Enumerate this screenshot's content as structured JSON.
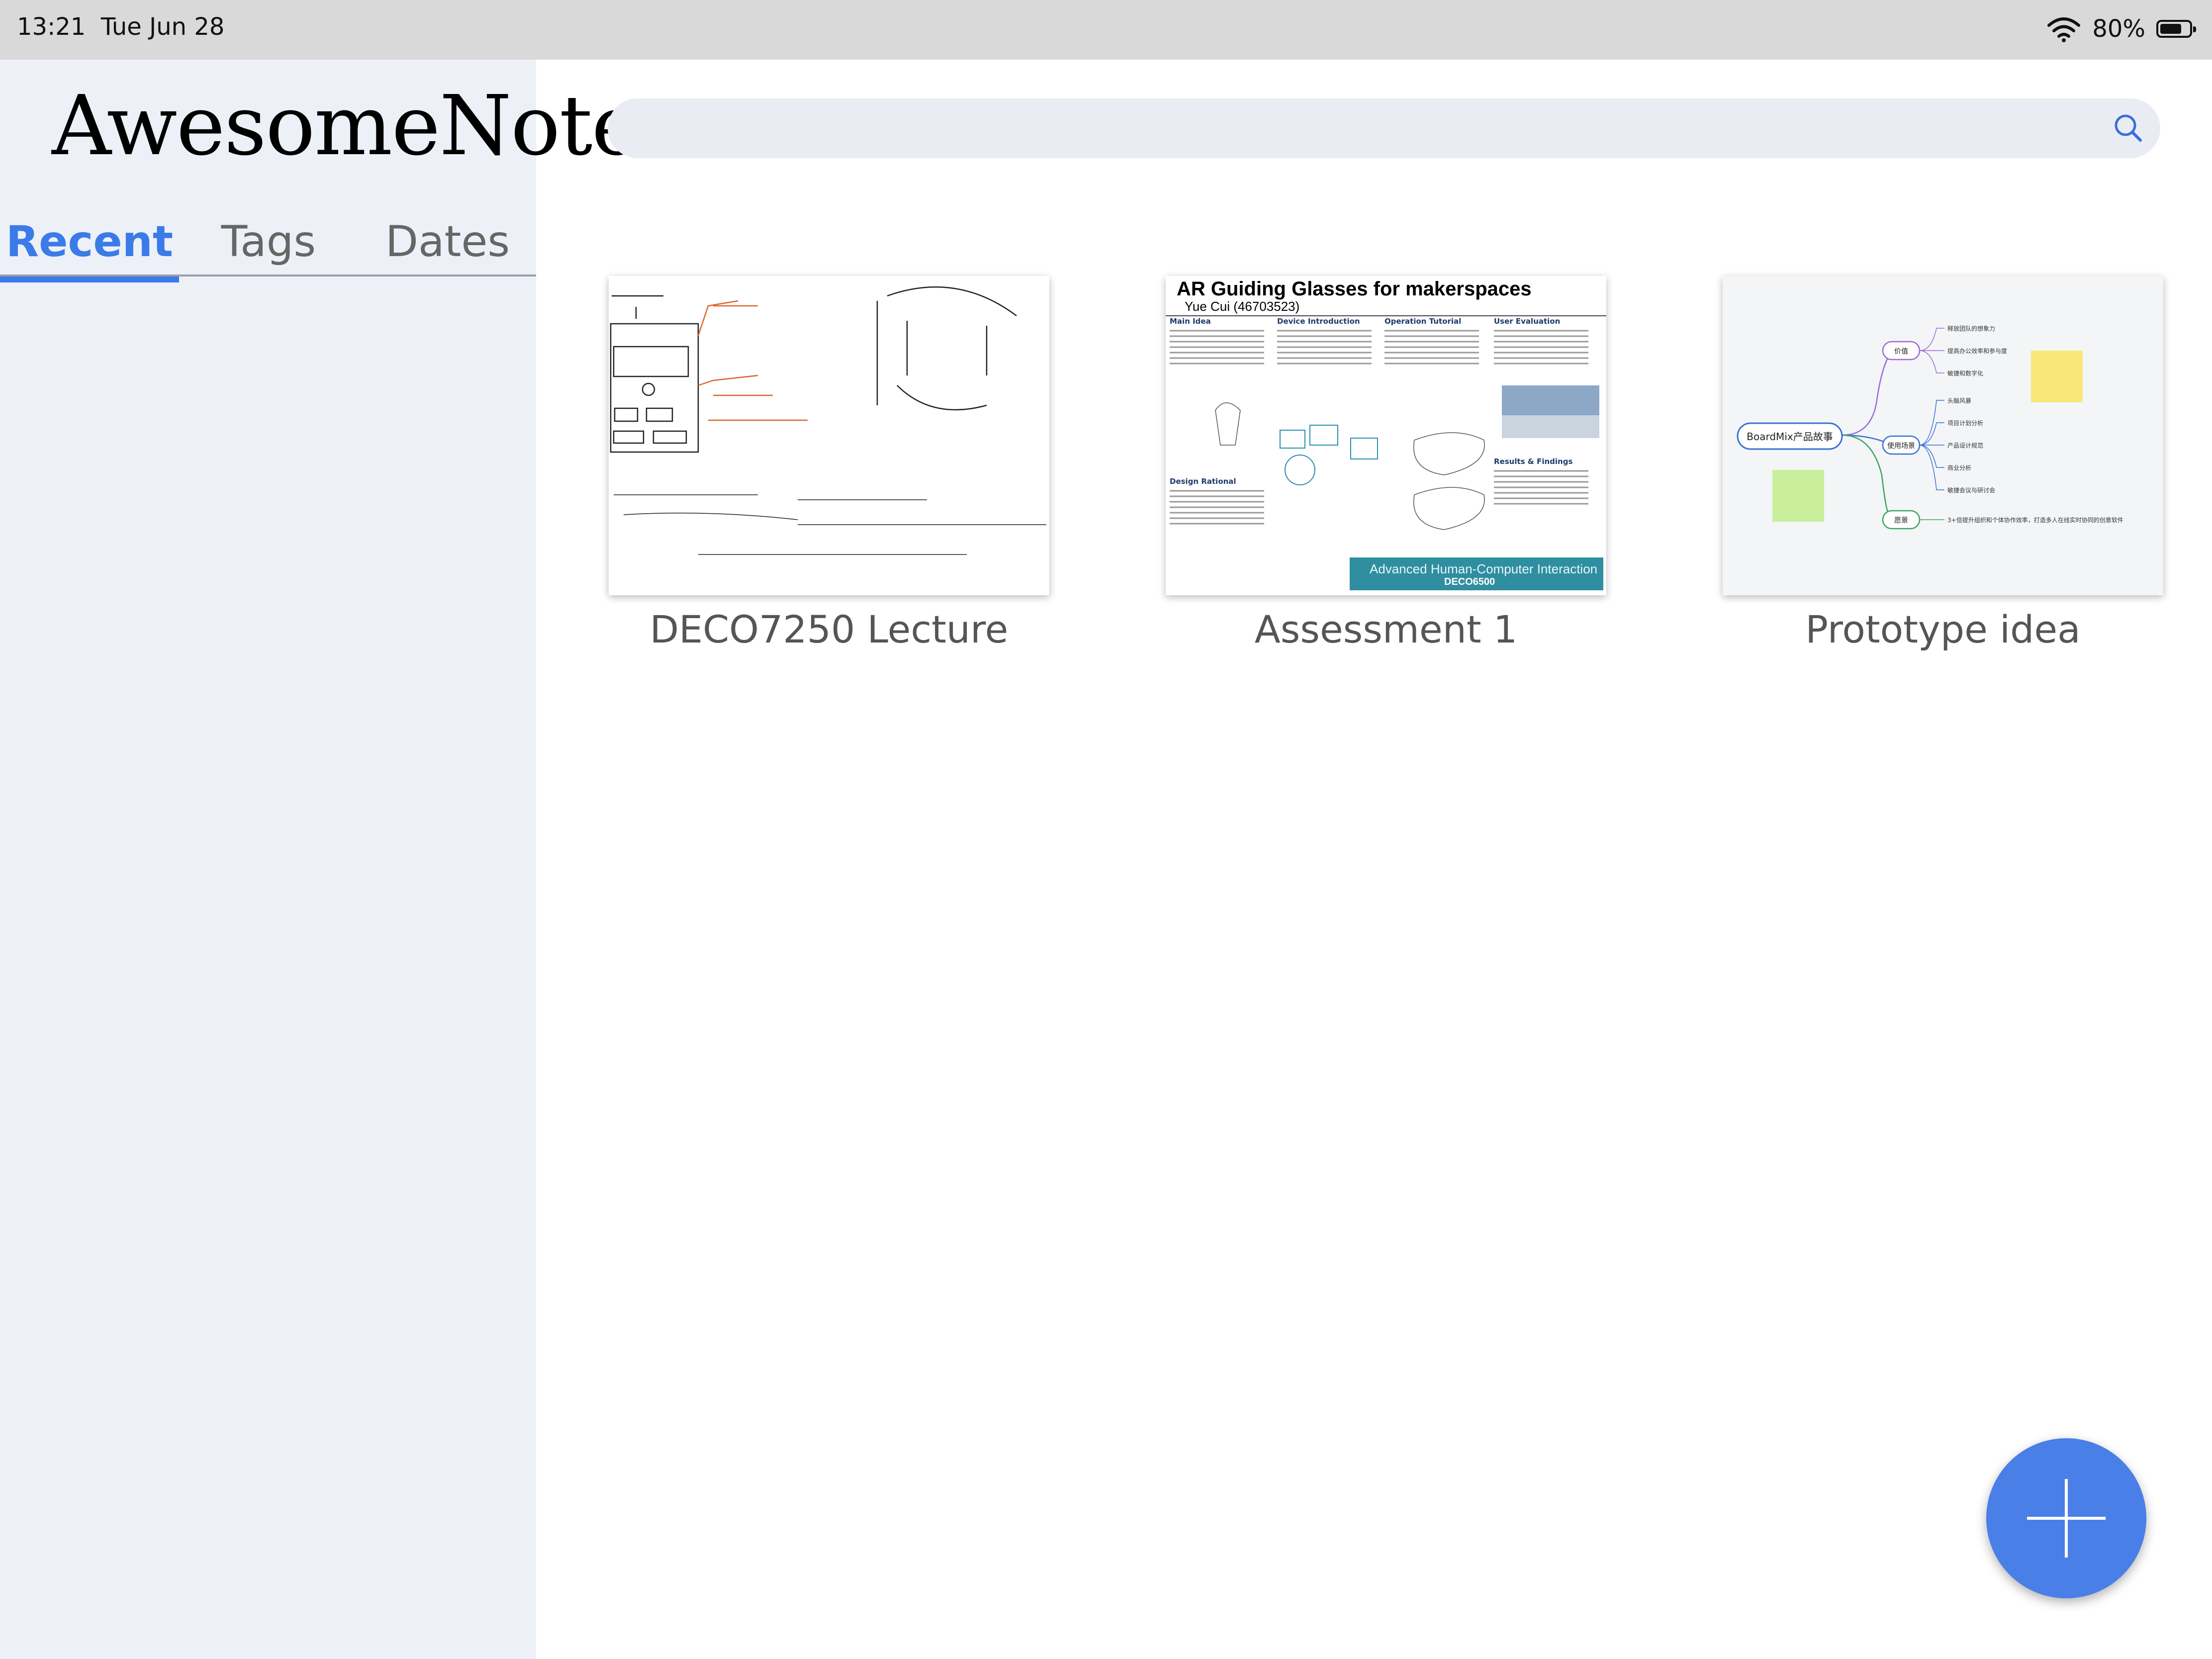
{
  "status_bar": {
    "time": "13:21",
    "date": "Tue  Jun 28",
    "battery": "80%",
    "battery_level": 0.8
  },
  "sidebar": {
    "app_title": "AwesomeNote",
    "tabs": [
      {
        "label": "Recent",
        "selected": true
      },
      {
        "label": "Tags",
        "selected": false
      },
      {
        "label": "Dates",
        "selected": false
      }
    ]
  },
  "search": {
    "placeholder": "",
    "value": ""
  },
  "notes": [
    {
      "title": "DECO7250 Lecture"
    },
    {
      "title": "Assessment 1",
      "thumbnail": {
        "heading": "AR Guiding Glasses for makerspaces",
        "author": "Yue Cui (46703523)",
        "section_titles": [
          "Main Idea",
          "Device Introduction",
          "Operation Tutorial",
          "User Evaluation",
          "Design Rational",
          "Results & Findings"
        ],
        "banner": "Advanced Human-Computer Interaction",
        "banner_code": "DECO6500"
      }
    },
    {
      "title": "Prototype idea",
      "thumbnail": {
        "root": "BoardMix产品故事",
        "branches": [
          {
            "label": "价值",
            "leaves": [
              "释放团队的想象力",
              "提高办公效率和参与度",
              "敏捷和数字化"
            ]
          },
          {
            "label": "使用场景",
            "leaves": [
              "头脑风暴",
              "项目计划分析",
              "产品设计规范",
              "商业分析",
              "敏捷会议与研讨会"
            ]
          },
          {
            "label": "愿景",
            "leaves": [
              "3+倍提升组织和个体协作效率，打造多人在线实时协同的创意软件"
            ]
          }
        ]
      }
    }
  ],
  "fab": {
    "label": "add-note"
  }
}
